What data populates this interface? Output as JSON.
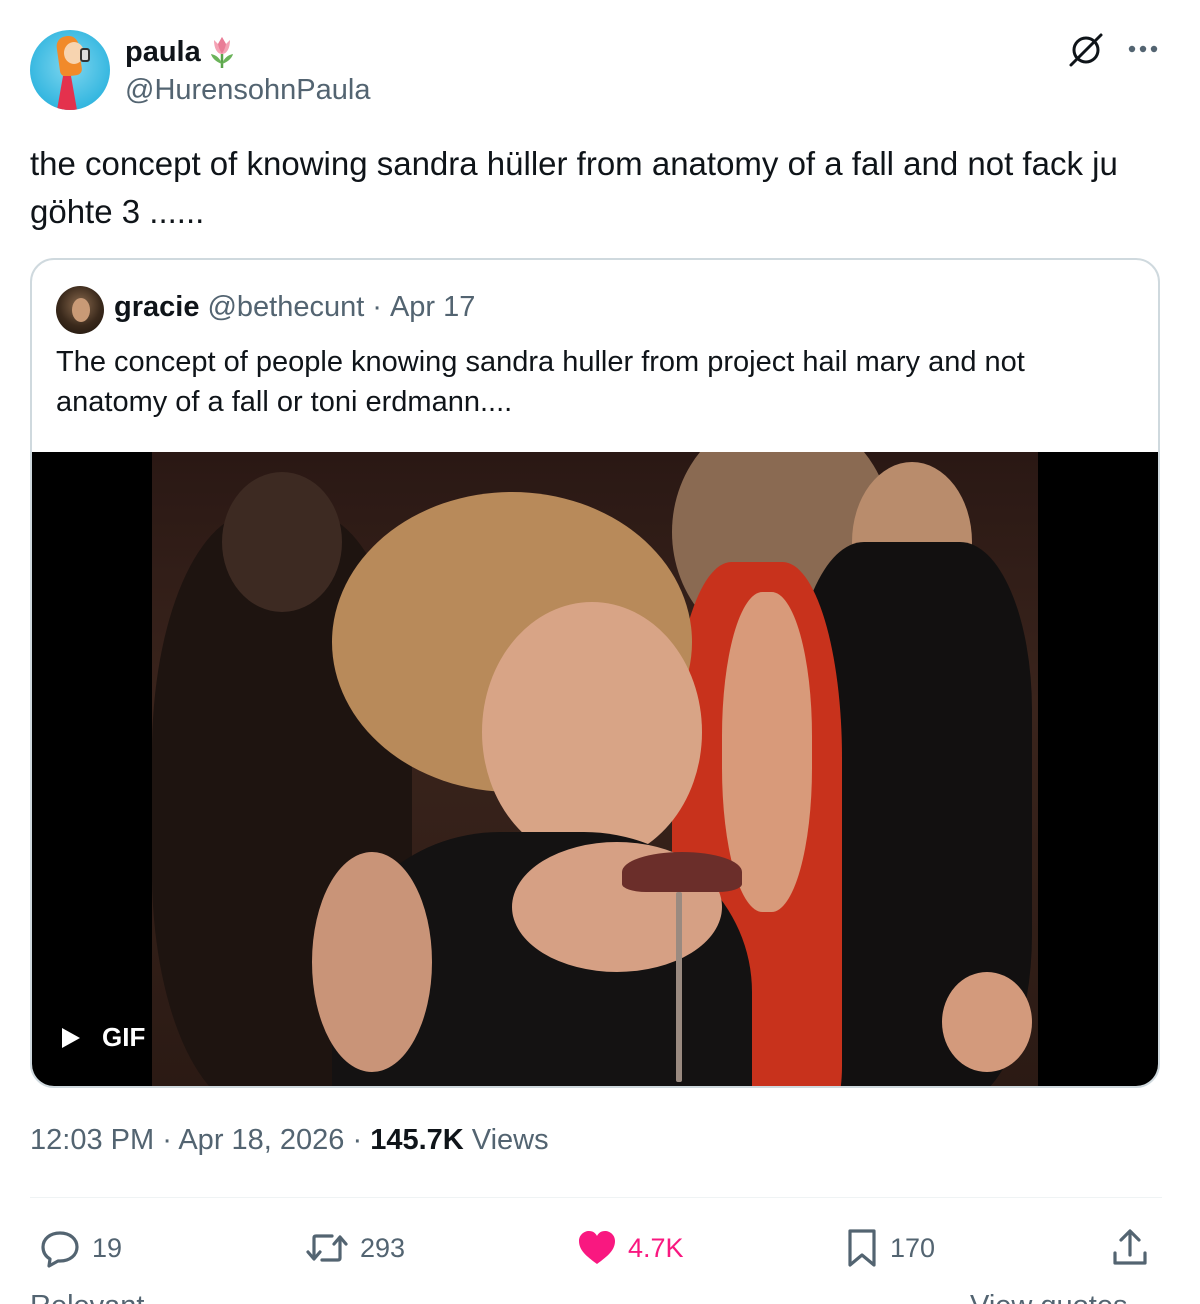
{
  "author": {
    "name": "paula",
    "name_emoji": "tulip",
    "handle": "@HurensohnPaula"
  },
  "tweet": {
    "text": "the concept of knowing sandra hüller from anatomy of a fall and not fack ju göhte 3 ......"
  },
  "quoted_tweet": {
    "name": "gracie",
    "handle": "@bethecunt",
    "separator": "·",
    "date": "Apr 17",
    "text": "The concept of people knowing sandra huller from project hail mary and not anatomy of a fall or toni erdmann....",
    "media": {
      "badge": "GIF",
      "play_icon": "play-icon"
    }
  },
  "meta": {
    "time": "12:03 PM",
    "sep1": "·",
    "date": "Apr 18, 2026",
    "sep2": "·",
    "views_count": "145.7K",
    "views_label": "Views"
  },
  "actions": {
    "replies": "19",
    "reposts": "293",
    "likes": "4.7K",
    "bookmarks": "170"
  },
  "footer": {
    "left": "Relevant",
    "right": "View quotes"
  },
  "colors": {
    "text": "#0f1419",
    "secondary": "#536471",
    "like": "#f91880",
    "border": "#cfd9de"
  }
}
